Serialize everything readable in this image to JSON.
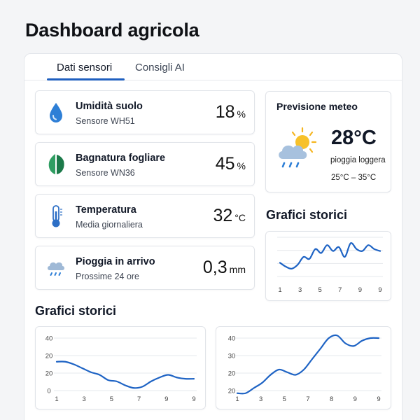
{
  "title": "Dashboard agricola",
  "tabs": [
    {
      "label": "Dati sensori",
      "active": true
    },
    {
      "label": "Consigli AI",
      "active": false
    }
  ],
  "sensors": [
    {
      "icon": "water-drop-icon",
      "title": "Umidità suolo",
      "subtitle": "Sensore WH51",
      "value": "18",
      "unit": "%"
    },
    {
      "icon": "leaf-icon",
      "title": "Bagnatura fogliare",
      "subtitle": "Sensore WN36",
      "value": "45",
      "unit": "%"
    },
    {
      "icon": "thermometer-icon",
      "title": "Temperatura",
      "subtitle": "Media giornaliera",
      "value": "32",
      "unit": "°C"
    },
    {
      "icon": "rain-cloud-icon",
      "title": "Pioggia in arrivo",
      "subtitle": "Prossime 24 ore",
      "value": "0,3",
      "unit": "mm"
    }
  ],
  "weather": {
    "title": "Previsione meteo",
    "icon": "sun-cloud-rain-icon",
    "temperature": "28°C",
    "condition": "pioggia loggera",
    "range": "25°C – 35°C"
  },
  "history_title_right": "Grafici storici",
  "history_title_bottom": "Grafici storici",
  "colors": {
    "accent": "#1f5fbf",
    "line": "#1e63c4",
    "drop": "#2e7fd6",
    "leaf": "#1f8a55",
    "sun": "#f5b51f",
    "cloud": "#9fb9d6"
  },
  "chart_data": [
    {
      "type": "line",
      "x": [
        1,
        1.5,
        2,
        2.5,
        3,
        3.5,
        4,
        4.5,
        5,
        5.5,
        6,
        6.5,
        7,
        7.5,
        8,
        8.5,
        9,
        9.5
      ],
      "series": [
        {
          "values": [
            21,
            19,
            18,
            20,
            24,
            23,
            28,
            26,
            30,
            27,
            29,
            24,
            31,
            28,
            27,
            30,
            28,
            27
          ]
        }
      ],
      "x_ticks": [
        "1",
        "3",
        "5",
        "7",
        "9",
        "9"
      ],
      "grid": true
    },
    {
      "type": "line",
      "x": [
        1,
        1.5,
        2,
        2.5,
        3,
        3.5,
        4,
        4.5,
        5,
        5.5,
        6,
        6.5,
        7,
        7.5,
        8,
        8.5,
        9
      ],
      "series": [
        {
          "values": [
            22,
            22,
            20,
            17,
            14,
            12,
            8,
            7,
            4,
            2,
            3,
            7,
            10,
            12,
            10,
            9,
            9
          ]
        }
      ],
      "x_ticks": [
        "1",
        "3",
        "5",
        "7",
        "9",
        "9"
      ],
      "y_ticks": [
        "40",
        "20",
        "20",
        "0"
      ],
      "ylim": [
        0,
        40
      ],
      "grid": true
    },
    {
      "type": "line",
      "x": [
        1,
        1.5,
        2,
        2.5,
        3,
        3.5,
        4,
        4.5,
        5,
        5.5,
        6,
        6.5,
        7,
        7.5,
        8,
        8.5,
        9,
        9.5
      ],
      "series": [
        {
          "values": [
            19,
            19,
            21,
            23,
            26,
            28,
            27,
            26,
            28,
            32,
            36,
            40,
            41,
            38,
            37,
            39,
            40,
            40
          ]
        }
      ],
      "x_ticks": [
        "1",
        "3",
        "5",
        "7",
        "8",
        "9",
        "9"
      ],
      "y_ticks": [
        "40",
        "30",
        "20",
        "20"
      ],
      "ylim": [
        20,
        40
      ],
      "grid": true
    }
  ]
}
